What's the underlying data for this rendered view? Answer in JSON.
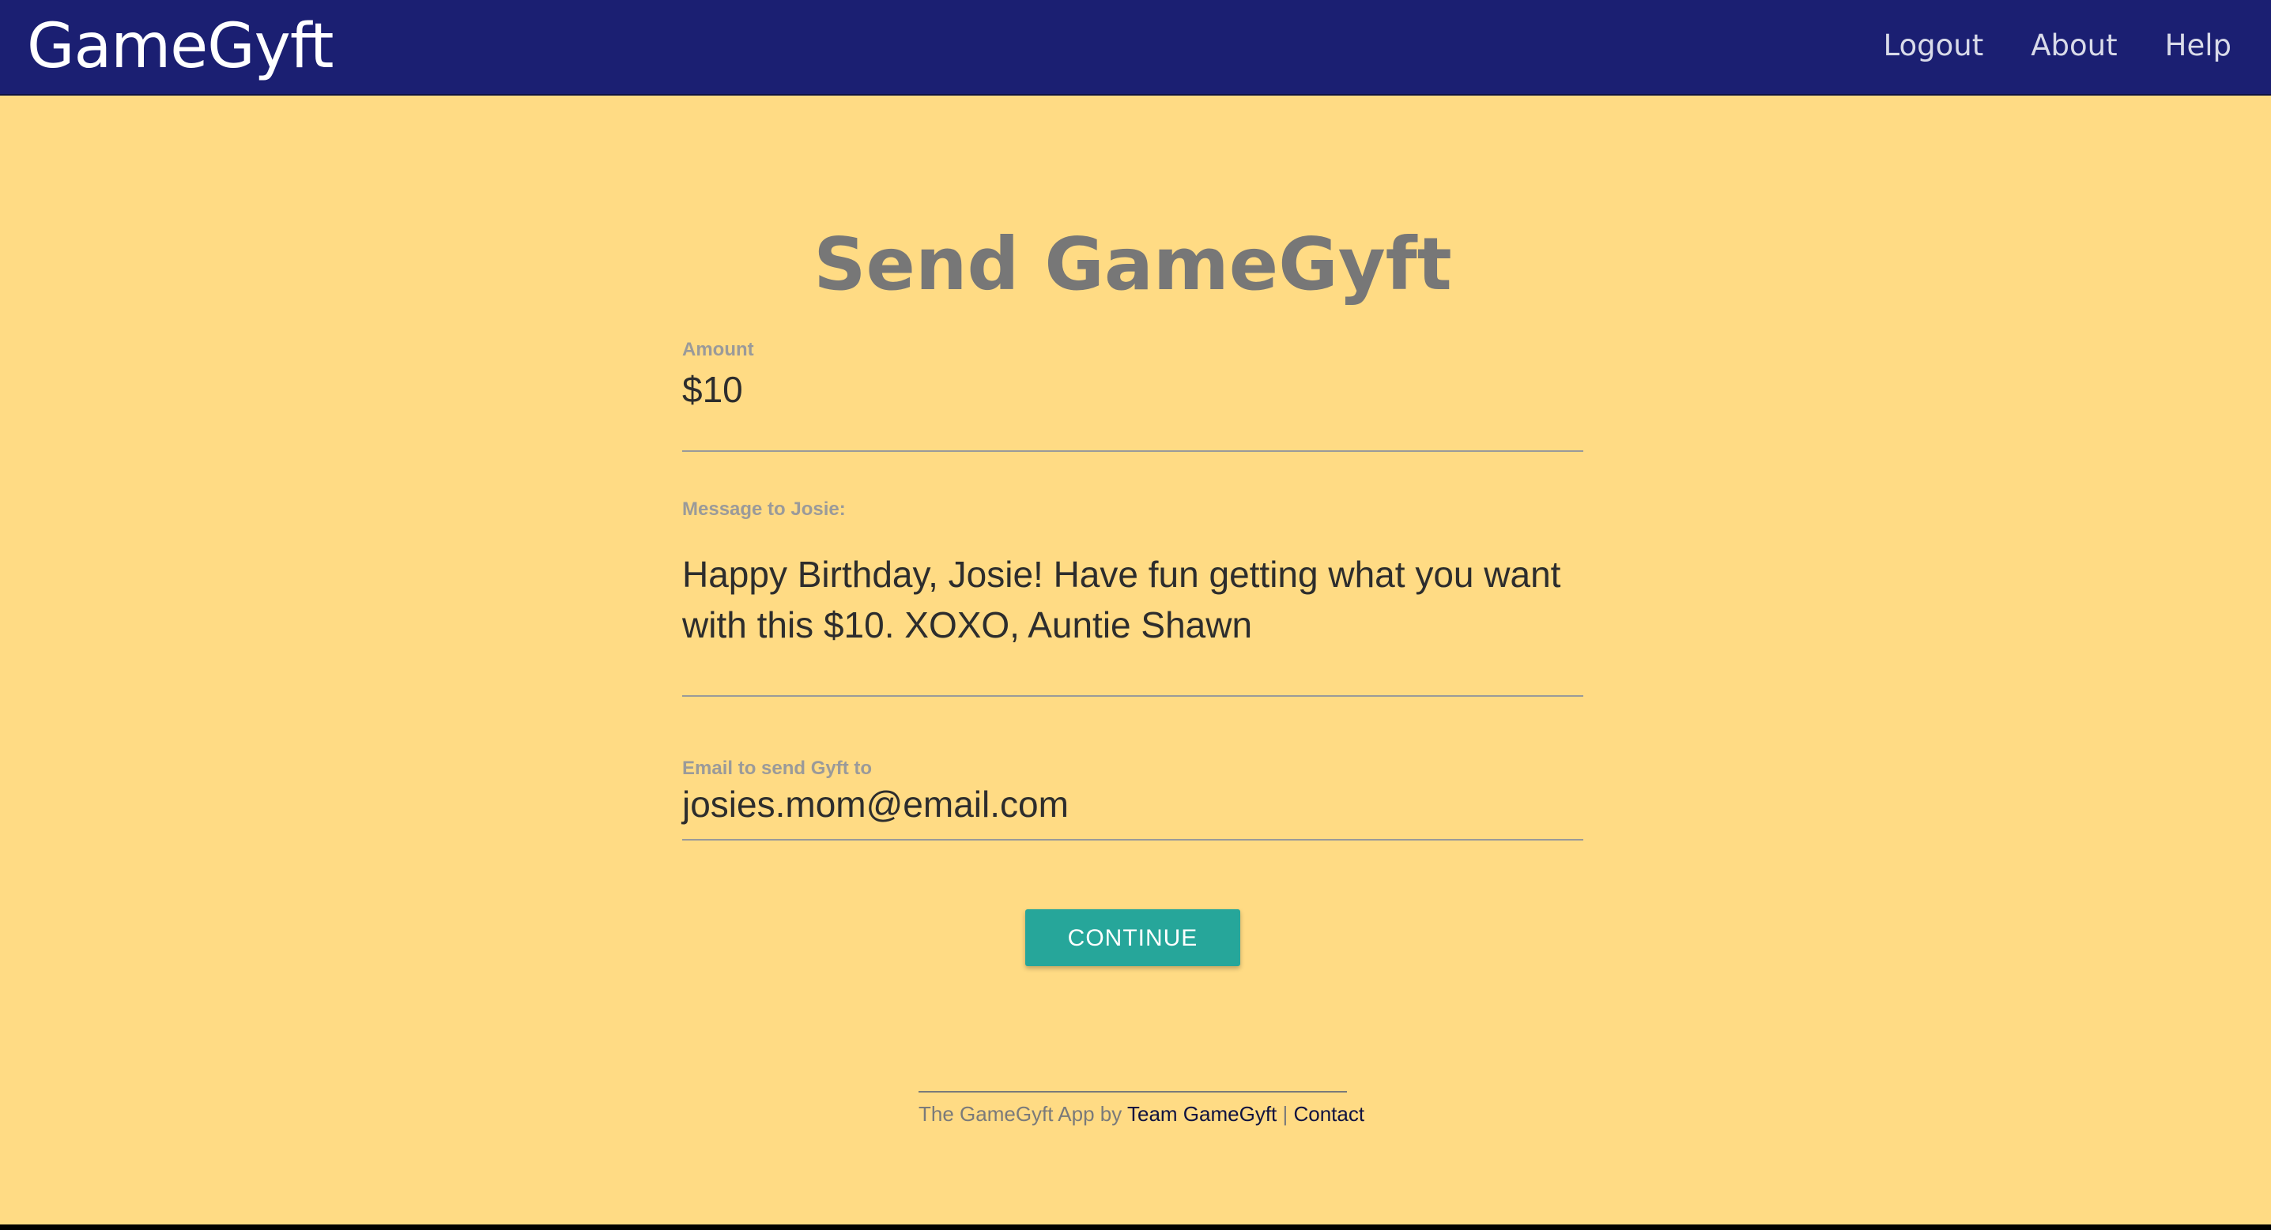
{
  "app": {
    "brand": "GameGyft"
  },
  "nav": {
    "items": [
      {
        "label": "Logout"
      },
      {
        "label": "About"
      },
      {
        "label": "Help"
      }
    ]
  },
  "main": {
    "title": "Send GameGyft",
    "amount": {
      "label": "Amount",
      "value": "$10"
    },
    "message": {
      "label": "Message to Josie:",
      "value": "Happy Birthday, Josie! Have fun getting what you want with this $10. XOXO, Auntie Shawn"
    },
    "email": {
      "label": "Email to send Gyft to",
      "value": "josies.mom@email.com"
    },
    "continue_label": "CONTINUE"
  },
  "footer": {
    "prefix": "The GameGyft App by ",
    "team_link": "Team GameGyft",
    "separator": " | ",
    "contact_link": "Contact"
  },
  "colors": {
    "navbar": "#1b1f72",
    "background": "#ffdb84",
    "button": "#26a69a",
    "title": "#777777"
  }
}
